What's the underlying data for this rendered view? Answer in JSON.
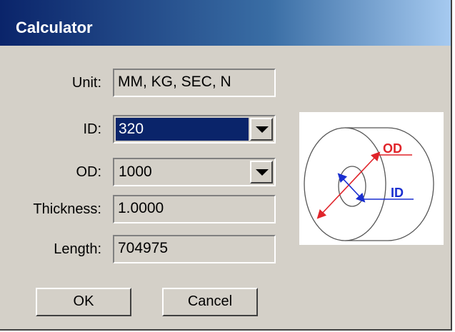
{
  "window": {
    "title": "Calculator"
  },
  "fields": {
    "unit": {
      "label": "Unit:",
      "value": "MM, KG, SEC, N"
    },
    "id": {
      "label": "ID:",
      "value": "320"
    },
    "od": {
      "label": "OD:",
      "value": "1000"
    },
    "thickness": {
      "label": "Thickness:",
      "value": "1.0000"
    },
    "length": {
      "label": "Length:",
      "value": "704975"
    }
  },
  "buttons": {
    "ok": "OK",
    "cancel": "Cancel"
  },
  "diagram": {
    "od_label": "OD",
    "id_label": "ID",
    "od_color": "#e0242a",
    "id_color": "#1a2fd0"
  },
  "colors": {
    "title_bar": "#0a246a",
    "selection": "#0a246a",
    "face": "#d4d0c8"
  }
}
